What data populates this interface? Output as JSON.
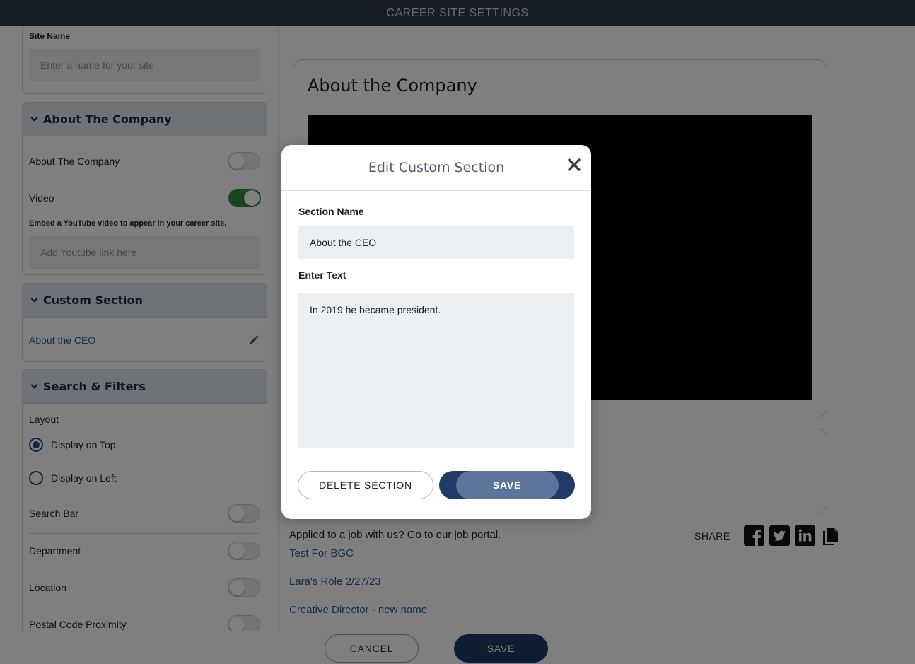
{
  "topbar": {
    "title": "CAREER SITE SETTINGS"
  },
  "sidebar": {
    "site_name": {
      "label": "Site Name",
      "placeholder": "Enter a name for your site"
    },
    "about_company": {
      "heading": "About The Company",
      "about_toggle_label": "About The Company",
      "about_toggle_on": false,
      "video_label": "Video",
      "video_toggle_on": true,
      "video_help": "Embed a YouTube video to appear in your career site.",
      "video_placeholder": "Add Youtube link here"
    },
    "custom_section": {
      "heading": "Custom Section",
      "item": "About the CEO"
    },
    "search_filters": {
      "heading": "Search & Filters",
      "layout_label": "Layout",
      "option_top": "Display on Top",
      "option_left": "Display on Left",
      "selected": "Display on Top",
      "search_bar": "Search Bar",
      "department": "Department",
      "location": "Location",
      "postal": "Postal Code Proximity"
    }
  },
  "preview": {
    "about_title": "About the Company",
    "applied_text": "Applied to a job with us? Go to our job portal.",
    "share_label": "SHARE",
    "share_icons": [
      "facebook-icon",
      "twitter-icon",
      "linkedin-icon",
      "copy-icon"
    ],
    "jobs": [
      "Test For BGC",
      "Lara's Role 2/27/23",
      "Creative Director - new name"
    ]
  },
  "bottombar": {
    "cancel_label": "CANCEL",
    "save_label": "SAVE"
  },
  "modal": {
    "title": "Edit Custom Section",
    "section_name_label": "Section Name",
    "section_name_value": "About the CEO",
    "enter_text_label": "Enter Text",
    "enter_text_value": "In 2019 he became president.",
    "delete_label": "DELETE SECTION",
    "save_label": "SAVE"
  }
}
